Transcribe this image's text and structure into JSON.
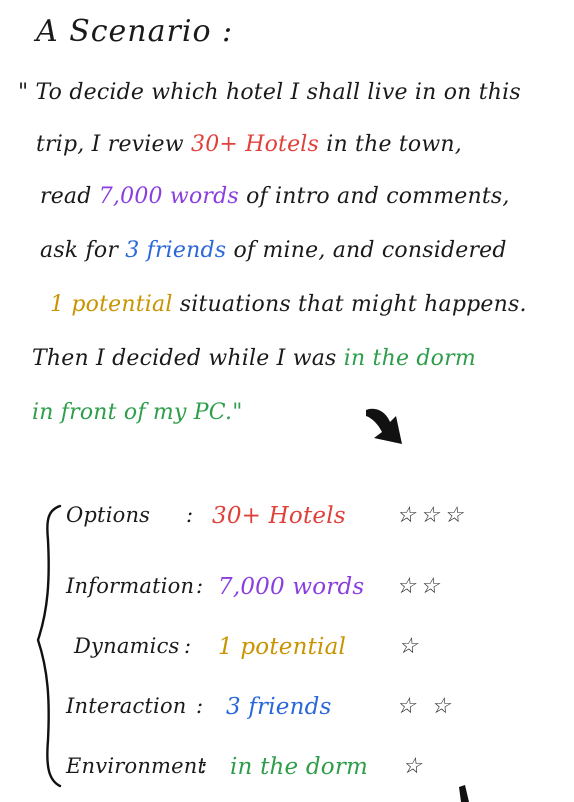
{
  "title": "A Scenario :",
  "scenario": {
    "lines": [
      [
        {
          "text": "\" To decide which hotel I shall live in on this",
          "color": ""
        }
      ],
      [
        {
          "text": "trip, I review ",
          "color": ""
        },
        {
          "text": "30+ Hotels",
          "color": "red"
        },
        {
          "text": " in the town,",
          "color": ""
        }
      ],
      [
        {
          "text": "read ",
          "color": ""
        },
        {
          "text": "7,000 words",
          "color": "purple"
        },
        {
          "text": " of intro and comments,",
          "color": ""
        }
      ],
      [
        {
          "text": "ask for ",
          "color": ""
        },
        {
          "text": "3 friends",
          "color": "blue"
        },
        {
          "text": " of mine, and considered",
          "color": ""
        }
      ],
      [
        {
          "text": "1 potential",
          "color": "gold"
        },
        {
          "text": " situations that might happens.",
          "color": ""
        }
      ],
      [
        {
          "text": "Then I decided while I was ",
          "color": ""
        },
        {
          "text": "in the dorm",
          "color": "green"
        }
      ],
      [
        {
          "text": "in front of my PC.\"",
          "color": "green"
        }
      ]
    ]
  },
  "summary": {
    "rows": [
      {
        "label": "Options",
        "value": "30+ Hotels",
        "value_color": "red",
        "stars": "☆☆☆",
        "star_count": 3
      },
      {
        "label": "Information",
        "value": "7,000 words",
        "value_color": "purple",
        "stars": "☆☆",
        "star_count": 2
      },
      {
        "label": "Dynamics",
        "value": "1 potential",
        "value_color": "gold",
        "stars": "☆",
        "star_count": 1
      },
      {
        "label": "Interaction",
        "value": "3 friends",
        "value_color": "blue",
        "stars": "☆ ☆",
        "star_count": 2
      },
      {
        "label": "Environment",
        "value": "in the dorm",
        "value_color": "green",
        "stars": "☆",
        "star_count": 1
      }
    ]
  },
  "colors": {
    "red": "#e0403a",
    "purple": "#8a3ee0",
    "blue": "#2a67d8",
    "gold": "#c99400",
    "green": "#2e9e4b",
    "ink": "#1a1a1a"
  },
  "icons": {
    "arrow": "curved-arrow-icon",
    "brace": "left-curly-brace",
    "star": "star-outline-icon"
  }
}
